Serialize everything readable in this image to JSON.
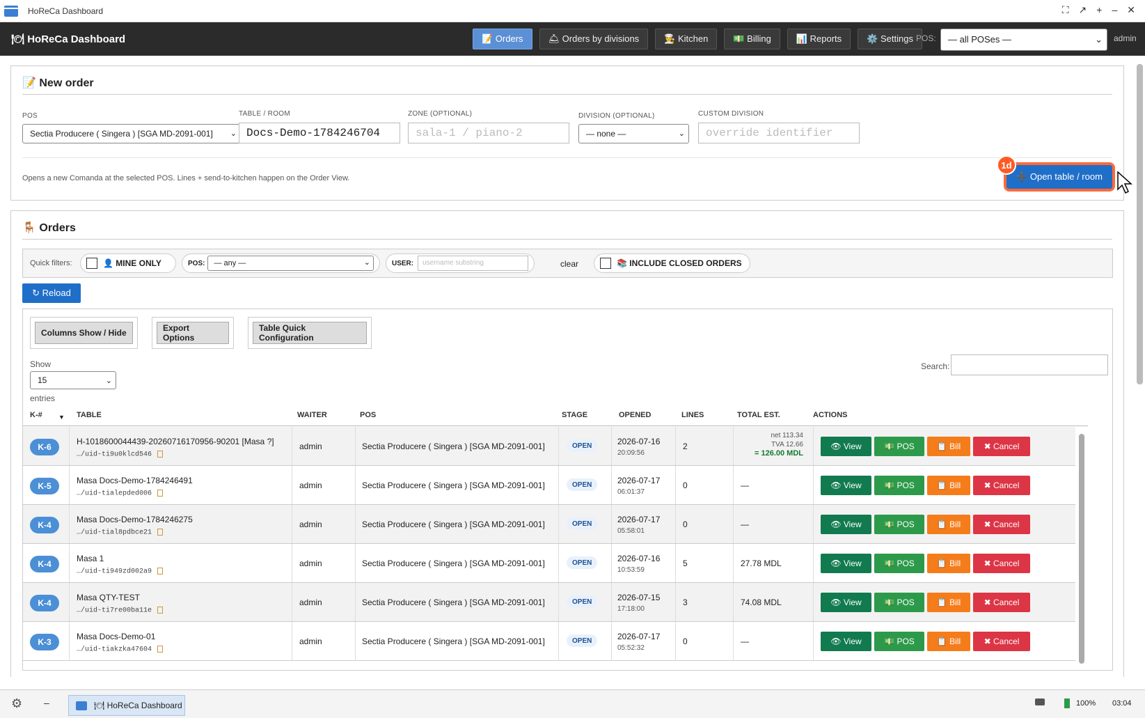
{
  "window": {
    "title": "HoReCa Dashboard",
    "controls": [
      "⛶",
      "↗",
      "+",
      "–",
      "✕"
    ]
  },
  "nav": {
    "brand": "🍽 HoReCa Dashboard",
    "items": [
      "📝 Orders",
      "🛎 Orders by divisions",
      "👨‍🍳 Kitchen",
      "💵 Billing",
      "📊 Reports",
      "⚙️ Settings"
    ],
    "pos_label": "POS:",
    "pos_value": "— all POSes —",
    "user": "admin"
  },
  "new_order": {
    "title": "📝 New order",
    "pos_label": "POS",
    "pos_value": "Sectia Producere ( Singera ) [SGA MD-2091-001]",
    "table_label": "TABLE / ROOM",
    "table_value": "Docs-Demo-1784246704",
    "zone_label": "ZONE (OPTIONAL)",
    "zone_placeholder": "sala-1 / piano-2",
    "division_label": "DIVISION (OPTIONAL)",
    "division_value": "— none —",
    "custom_label": "CUSTOM DIVISION",
    "custom_placeholder": "override identifier",
    "help": "Opens a new Comanda at the selected POS. Lines + send-to-kitchen happen on the Order View.",
    "open_button": "➕ Open table / room",
    "annotation": "1d"
  },
  "orders": {
    "title": "🪑 Orders",
    "quick_label": "Quick filters:",
    "mine_only": "👤 MINE ONLY",
    "pos_filter_label": "POS:",
    "pos_filter_value": "— any —",
    "user_label": "USER:",
    "user_placeholder": "username substring",
    "clear": "clear",
    "include_closed": "📚 INCLUDE CLOSED ORDERS",
    "reload": "↻ Reload",
    "columns_btn": "Columns Show / Hide",
    "export_btn": "Export Options",
    "quick_config_btn": "Table Quick Configuration",
    "show_label": "Show",
    "show_value": "15",
    "entries_label": "entries",
    "search_label": "Search:",
    "headers": [
      "K-#",
      "TABLE",
      "WAITER",
      "POS",
      "STAGE",
      "OPENED",
      "LINES",
      "TOTAL EST.",
      "ACTIONS"
    ],
    "rows": [
      {
        "k": "K-6",
        "table": "H-1018600044439-20260716170956-90201 [Masa ?]",
        "uid": "…/uid-ti9u0klcd546",
        "waiter": "admin",
        "pos": "Sectia Producere ( Singera ) [SGA MD-2091-001]",
        "stage": "OPEN",
        "date": "2026-07-16",
        "time": "20:09:56",
        "lines": "2",
        "total": "",
        "net": "net 113.34",
        "tva": "TVA 12.66",
        "grand": "= 126.00 MDL"
      },
      {
        "k": "K-5",
        "table": "Masa Docs-Demo-1784246491",
        "uid": "…/uid-tialepded006",
        "waiter": "admin",
        "pos": "Sectia Producere ( Singera ) [SGA MD-2091-001]",
        "stage": "OPEN",
        "date": "2026-07-17",
        "time": "06:01:37",
        "lines": "0",
        "total": "—"
      },
      {
        "k": "K-4",
        "table": "Masa Docs-Demo-1784246275",
        "uid": "…/uid-tial8pdbce21",
        "waiter": "admin",
        "pos": "Sectia Producere ( Singera ) [SGA MD-2091-001]",
        "stage": "OPEN",
        "date": "2026-07-17",
        "time": "05:58:01",
        "lines": "0",
        "total": "—"
      },
      {
        "k": "K-4",
        "table": "Masa 1",
        "uid": "…/uid-ti949zd002a9",
        "waiter": "admin",
        "pos": "Sectia Producere ( Singera ) [SGA MD-2091-001]",
        "stage": "OPEN",
        "date": "2026-07-16",
        "time": "10:53:59",
        "lines": "5",
        "total": "27.78 MDL"
      },
      {
        "k": "K-4",
        "table": "Masa QTY-TEST",
        "uid": "…/uid-ti7re00ba11e",
        "waiter": "admin",
        "pos": "Sectia Producere ( Singera ) [SGA MD-2091-001]",
        "stage": "OPEN",
        "date": "2026-07-15",
        "time": "17:18:00",
        "lines": "3",
        "total": "74.08 MDL"
      },
      {
        "k": "K-3",
        "table": "Masa Docs-Demo-01",
        "uid": "…/uid-tiakzka47604",
        "waiter": "admin",
        "pos": "Sectia Producere ( Singera ) [SGA MD-2091-001]",
        "stage": "OPEN",
        "date": "2026-07-17",
        "time": "05:52:32",
        "lines": "0",
        "total": "—"
      }
    ],
    "actions": {
      "view": "👁 View",
      "pos": "💵 POS",
      "bill": "📋 Bill",
      "cancel": "✖ Cancel"
    }
  },
  "taskbar": {
    "task": "🍽 HoReCa Dashboard",
    "battery": "100%",
    "clock": "03:04"
  }
}
